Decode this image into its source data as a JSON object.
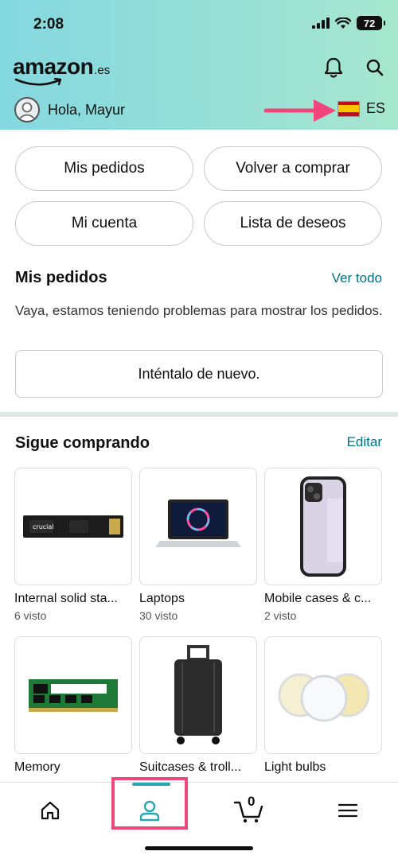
{
  "status": {
    "time": "2:08",
    "battery": "72"
  },
  "header": {
    "logo": "amazon",
    "logo_suffix": ".es",
    "greeting": "Hola, Mayur",
    "locale": "ES"
  },
  "quick_links": [
    "Mis pedidos",
    "Volver a comprar",
    "Mi cuenta",
    "Lista de deseos"
  ],
  "orders": {
    "title": "Mis pedidos",
    "link": "Ver todo",
    "message": "Vaya, estamos teniendo problemas para mostrar los pedidos.",
    "retry": "Inténtalo de nuevo."
  },
  "keep_shopping": {
    "title": "Sigue comprando",
    "link": "Editar",
    "items": [
      {
        "title": "Internal solid sta...",
        "sub": "6 visto"
      },
      {
        "title": "Laptops",
        "sub": "30 visto"
      },
      {
        "title": "Mobile cases & c...",
        "sub": "2 visto"
      },
      {
        "title": "Memory",
        "sub": ""
      },
      {
        "title": "Suitcases & troll...",
        "sub": ""
      },
      {
        "title": "Light bulbs",
        "sub": ""
      }
    ]
  },
  "tabbar": {
    "cart_count": "0"
  },
  "colors": {
    "accent": "#2aa6b5",
    "link": "#007185",
    "highlight": "#f0467c"
  }
}
